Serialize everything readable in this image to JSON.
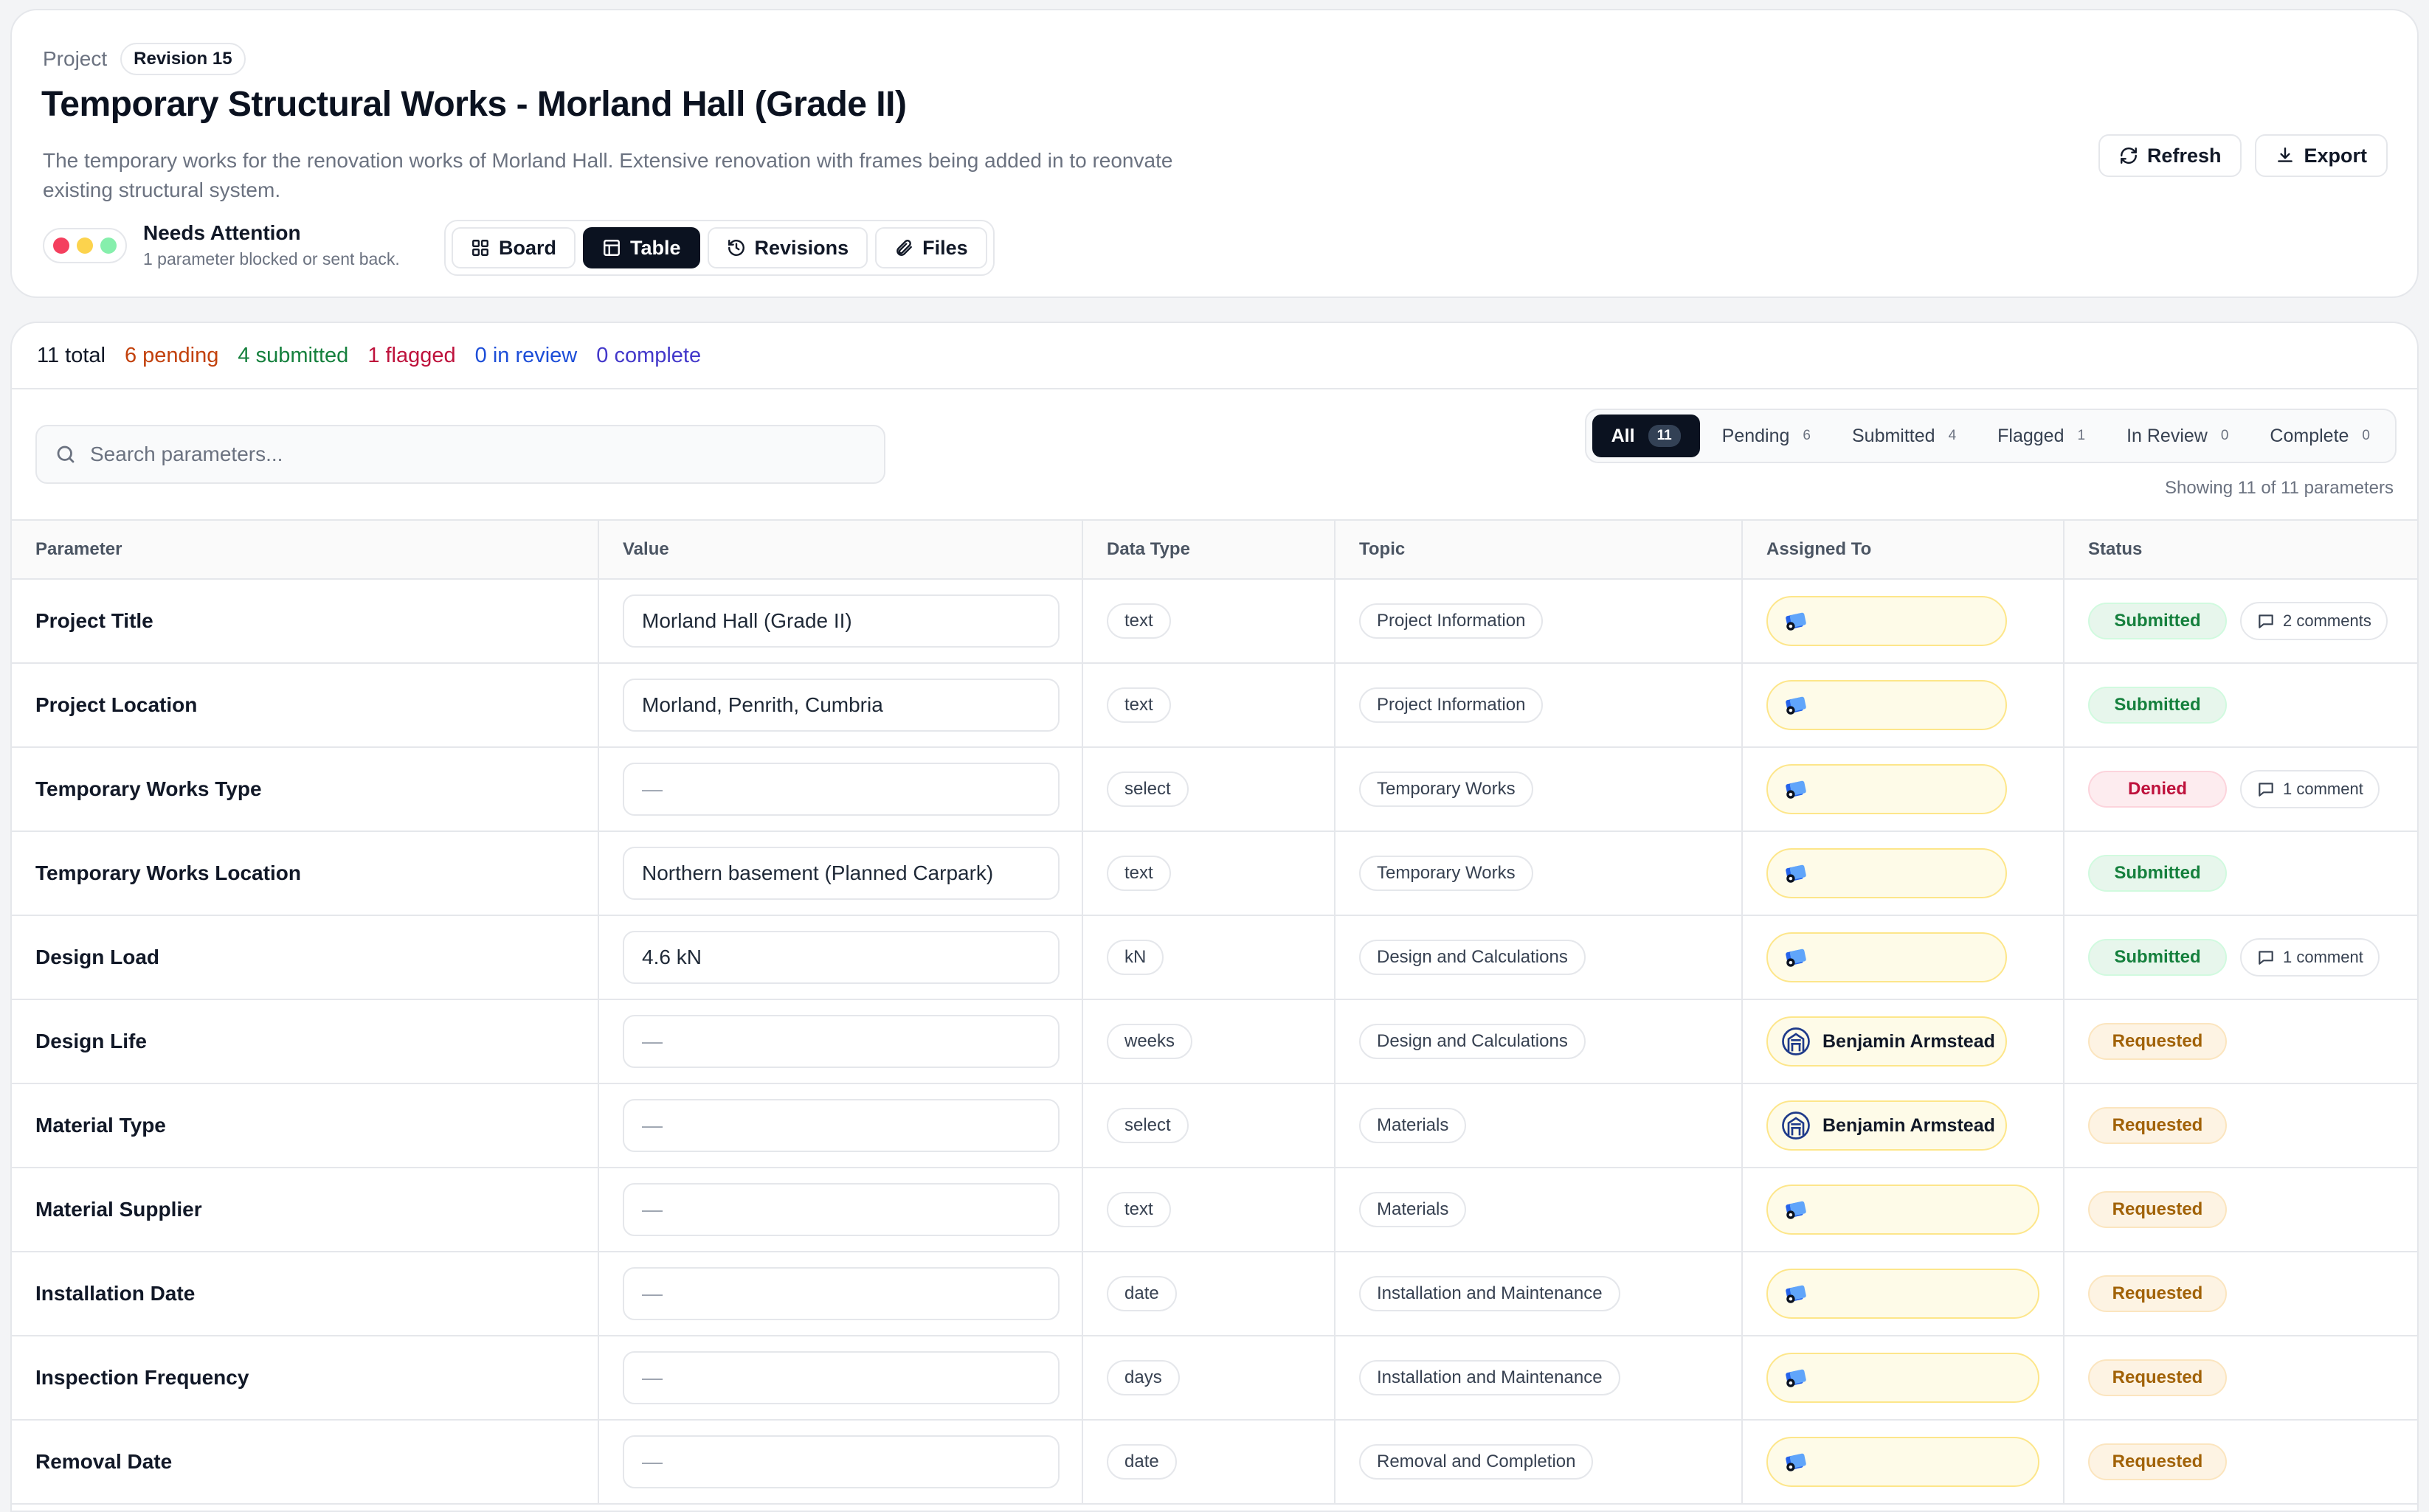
{
  "header": {
    "project_label": "Project",
    "revision": "Revision 15",
    "title": "Temporary Structural Works - Morland Hall (Grade II)",
    "description": "The temporary works for the renovation works of Morland Hall. Extensive renovation with frames being added in to reonvate existing structural system.",
    "refresh_label": "Refresh",
    "export_label": "Export",
    "status_title": "Needs Attention",
    "status_subtitle": "1 parameter blocked or sent back.",
    "views": [
      {
        "label": "Board",
        "icon": "grid-icon"
      },
      {
        "label": "Table",
        "icon": "table-icon",
        "active": true
      },
      {
        "label": "Revisions",
        "icon": "history-icon"
      },
      {
        "label": "Files",
        "icon": "paperclip-icon"
      }
    ],
    "traffic_colors": [
      "#f43f5e",
      "#fcd34d",
      "#86efac"
    ]
  },
  "summary": {
    "total": "11 total",
    "pending": "6 pending",
    "submitted": "4 submitted",
    "flagged": "1 flagged",
    "in_review": "0 in review",
    "complete": "0 complete"
  },
  "search": {
    "placeholder": "Search parameters..."
  },
  "filters": [
    {
      "label": "All",
      "count": "11",
      "active": true
    },
    {
      "label": "Pending",
      "count": "6"
    },
    {
      "label": "Submitted",
      "count": "4"
    },
    {
      "label": "Flagged",
      "count": "1"
    },
    {
      "label": "In Review",
      "count": "0"
    },
    {
      "label": "Complete",
      "count": "0"
    }
  ],
  "showing": "Showing 11 of 11 parameters",
  "table": {
    "headers": [
      "Parameter",
      "Value",
      "Data Type",
      "Topic",
      "Assigned To",
      "Status"
    ],
    "rows": [
      {
        "parameter": "Project Title",
        "value": "Morland Hall (Grade II)",
        "type": "text",
        "topic": "Project Information",
        "assignee": "",
        "status": "Submitted",
        "comments": "2 comments"
      },
      {
        "parameter": "Project Location",
        "value": "Morland, Penrith, Cumbria",
        "type": "text",
        "topic": "Project Information",
        "assignee": "",
        "status": "Submitted",
        "comments": ""
      },
      {
        "parameter": "Temporary Works Type",
        "value": "—",
        "type": "select",
        "topic": "Temporary Works",
        "assignee": "",
        "status": "Denied",
        "comments": "1 comment"
      },
      {
        "parameter": "Temporary Works Location",
        "value": "Northern basement (Planned Carpark)",
        "type": "text",
        "topic": "Temporary Works",
        "assignee": "",
        "status": "Submitted",
        "comments": ""
      },
      {
        "parameter": "Design Load",
        "value": "4.6 kN",
        "type": "kN",
        "topic": "Design and Calculations",
        "assignee": "",
        "status": "Submitted",
        "comments": "1 comment"
      },
      {
        "parameter": "Design Life",
        "value": "—",
        "type": "weeks",
        "topic": "Design and Calculations",
        "assignee": "Benjamin Armstead",
        "status": "Requested",
        "comments": ""
      },
      {
        "parameter": "Material Type",
        "value": "—",
        "type": "select",
        "topic": "Materials",
        "assignee": "Benjamin Armstead",
        "status": "Requested",
        "comments": ""
      },
      {
        "parameter": "Material Supplier",
        "value": "—",
        "type": "text",
        "topic": "Materials",
        "assignee": "",
        "status": "Requested",
        "comments": ""
      },
      {
        "parameter": "Installation Date",
        "value": "—",
        "type": "date",
        "topic": "Installation and Maintenance",
        "assignee": "",
        "status": "Requested",
        "comments": ""
      },
      {
        "parameter": "Inspection Frequency",
        "value": "—",
        "type": "days",
        "topic": "Installation and Maintenance",
        "assignee": "",
        "status": "Requested",
        "comments": ""
      },
      {
        "parameter": "Removal Date",
        "value": "—",
        "type": "date",
        "topic": "Removal and Completion",
        "assignee": "",
        "status": "Requested",
        "comments": ""
      }
    ]
  },
  "colors": {
    "submitted": "#15803d",
    "denied": "#be123c",
    "requested": "#a16207",
    "dark": "#0b1220"
  }
}
